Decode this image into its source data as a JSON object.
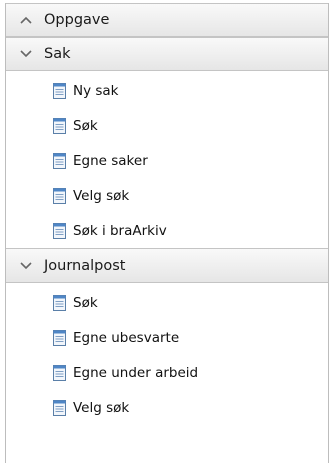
{
  "sections": [
    {
      "title": "Oppgave",
      "expanded": false,
      "items": []
    },
    {
      "title": "Sak",
      "expanded": true,
      "items": [
        {
          "label": "Ny sak"
        },
        {
          "label": "Søk"
        },
        {
          "label": "Egne saker"
        },
        {
          "label": "Velg søk"
        },
        {
          "label": "Søk i braArkiv"
        }
      ]
    },
    {
      "title": "Journalpost",
      "expanded": true,
      "items": [
        {
          "label": "Søk"
        },
        {
          "label": "Egne ubesvarte"
        },
        {
          "label": "Egne under arbeid"
        },
        {
          "label": "Velg søk"
        }
      ]
    }
  ],
  "icons": {
    "collapsed_chevron": "chevron-up-icon",
    "expanded_chevron": "chevron-down-icon",
    "item_icon": "document-icon"
  }
}
